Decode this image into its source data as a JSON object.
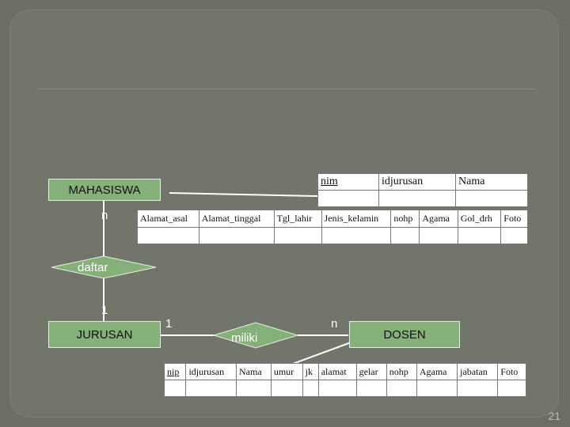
{
  "entities": {
    "mahasiswa": "MAHASISWA",
    "jurusan": "JURUSAN",
    "dosen": "DOSEN"
  },
  "relations": {
    "daftar": "daftar",
    "miliki": "miliki"
  },
  "cardinalities": {
    "mahasiswa_daftar": "n",
    "daftar_jurusan": "1",
    "jurusan_miliki": "1",
    "miliki_dosen": "n"
  },
  "mahasiswa_table_1": {
    "columns": [
      "nim",
      "idjurusan",
      "Nama"
    ]
  },
  "mahasiswa_table_2": {
    "columns": [
      "Alamat_asal",
      "Alamat_tinggal",
      "Tgl_lahir",
      "Jenis_kelamin",
      "nohp",
      "Agama",
      "Gol_drh",
      "Foto"
    ]
  },
  "dosen_table": {
    "columns": [
      "nip",
      "idjurusan",
      "Nama",
      "umur",
      "jk",
      "alamat",
      "gelar",
      "nohp",
      "Agama",
      "jabatan",
      "Foto"
    ]
  },
  "page_number": "21"
}
